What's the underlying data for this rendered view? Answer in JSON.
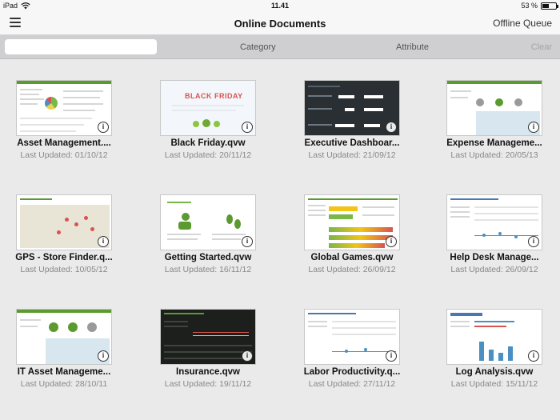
{
  "status_bar": {
    "device": "iPad",
    "time": "11.41",
    "battery": "53 %",
    "battery_level": 0.53
  },
  "nav": {
    "title": "Online Documents",
    "offline_queue": "Offline Queue"
  },
  "filter_bar": {
    "search_placeholder": "",
    "category": "Category",
    "attribute": "Attribute",
    "clear": "Clear"
  },
  "info_icon_glyph": "i",
  "documents": [
    {
      "title": "Asset Management....",
      "date": "Last Updated: 01/10/12",
      "thumb": "dashboard-green"
    },
    {
      "title": "Black Friday.qvw",
      "date": "Last Updated: 20/11/12",
      "thumb": "black-friday"
    },
    {
      "title": "Executive Dashboar...",
      "date": "Last Updated: 21/09/12",
      "thumb": "executive-dark"
    },
    {
      "title": "Expense Manageme...",
      "date": "Last Updated: 20/05/13",
      "thumb": "dashboard-map"
    },
    {
      "title": "GPS - Store Finder.q...",
      "date": "Last Updated: 10/05/12",
      "thumb": "map"
    },
    {
      "title": "Getting Started.qvw",
      "date": "Last Updated: 16/11/12",
      "thumb": "getting-started"
    },
    {
      "title": "Global Games.qvw",
      "date": "Last Updated: 26/09/12",
      "thumb": "global-games"
    },
    {
      "title": "Help Desk Manage...",
      "date": "Last Updated: 26/09/12",
      "thumb": "table-chart"
    },
    {
      "title": "IT Asset Manageme...",
      "date": "Last Updated: 28/10/11",
      "thumb": "dashboard-map"
    },
    {
      "title": "Insurance.qvw",
      "date": "Last Updated: 19/11/12",
      "thumb": "insurance-dark"
    },
    {
      "title": "Labor Productivity.q...",
      "date": "Last Updated: 27/11/12",
      "thumb": "table-chart"
    },
    {
      "title": "Log Analysis.qvw",
      "date": "Last Updated: 15/11/12",
      "thumb": "log-analysis"
    }
  ]
}
